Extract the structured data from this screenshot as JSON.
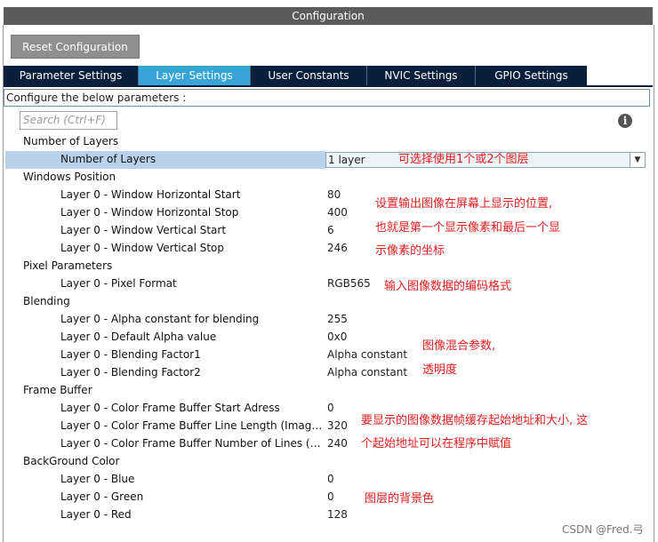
{
  "window": {
    "title": "Configuration"
  },
  "toolbar": {
    "reset_label": "Reset Configuration"
  },
  "tabs": [
    {
      "label": "Parameter Settings",
      "active": false
    },
    {
      "label": "Layer Settings",
      "active": true
    },
    {
      "label": "User Constants",
      "active": false
    },
    {
      "label": "NVIC Settings",
      "active": false
    },
    {
      "label": "GPIO Settings",
      "active": false
    }
  ],
  "description": "Configure the below parameters :",
  "search": {
    "placeholder": "Search (Ctrl+F)"
  },
  "groups": {
    "number_of_layers": {
      "title": "Number of Layers",
      "params": [
        {
          "label": "Number of Layers",
          "value": "1 layer"
        }
      ]
    },
    "windows_position": {
      "title": "Windows Position",
      "params": [
        {
          "label": "Layer 0 - Window Horizontal Start",
          "value": "80"
        },
        {
          "label": "Layer 0 - Window Horizontal Stop",
          "value": "400"
        },
        {
          "label": "Layer 0 - Window Vertical Start",
          "value": "6"
        },
        {
          "label": "Layer 0 - Window Vertical Stop",
          "value": "246"
        }
      ]
    },
    "pixel_parameters": {
      "title": "Pixel Parameters",
      "params": [
        {
          "label": "Layer 0 - Pixel Format",
          "value": "RGB565"
        }
      ]
    },
    "blending": {
      "title": "Blending",
      "params": [
        {
          "label": "Layer 0 - Alpha constant for blending",
          "value": "255"
        },
        {
          "label": "Layer 0 - Default Alpha value",
          "value": "0x0"
        },
        {
          "label": "Layer 0 - Blending Factor1",
          "value": "Alpha constant"
        },
        {
          "label": "Layer 0 - Blending Factor2",
          "value": "Alpha constant"
        }
      ]
    },
    "frame_buffer": {
      "title": "Frame Buffer",
      "params": [
        {
          "label": "Layer 0 - Color Frame Buffer Start Adress",
          "value": "0"
        },
        {
          "label": "Layer 0 - Color Frame Buffer Line Length (Image ...",
          "value": "320"
        },
        {
          "label": "Layer 0 - Color Frame Buffer Number of Lines (Im...",
          "value": "240"
        }
      ]
    },
    "background_color": {
      "title": "BackGround Color",
      "params": [
        {
          "label": "Layer 0 - Blue",
          "value": "0"
        },
        {
          "label": "Layer 0 - Green",
          "value": "0"
        },
        {
          "label": "Layer 0 - Red",
          "value": "128"
        }
      ]
    }
  },
  "annotations": {
    "layers": "可选择使用1个或2个图层",
    "position_1": "设置输出图像在屏幕上显示的位置,",
    "position_2": "也就是第一个显示像素和最后一个显",
    "position_3": "示像素的坐标",
    "pixel_format": "输入图像数据的编码格式",
    "blending_1": "图像混合参数,",
    "blending_2": "透明度",
    "frame_buffer_1": "要显示的图像数据帧缓存起始地址和大小, 这",
    "frame_buffer_2": "个起始地址可以在程序中赋值",
    "background": "图层的背景色"
  },
  "watermark": "CSDN @Fred.弓",
  "colors": {
    "title_bar": "#5b5b5b",
    "tab_bg": "#0a1f3b",
    "tab_active": "#39a5d6",
    "selected_row": "#b9d2ea",
    "annotation": "#e01e1e"
  },
  "icons": {
    "info": "info-icon",
    "dropdown": "chevron-down-icon"
  }
}
